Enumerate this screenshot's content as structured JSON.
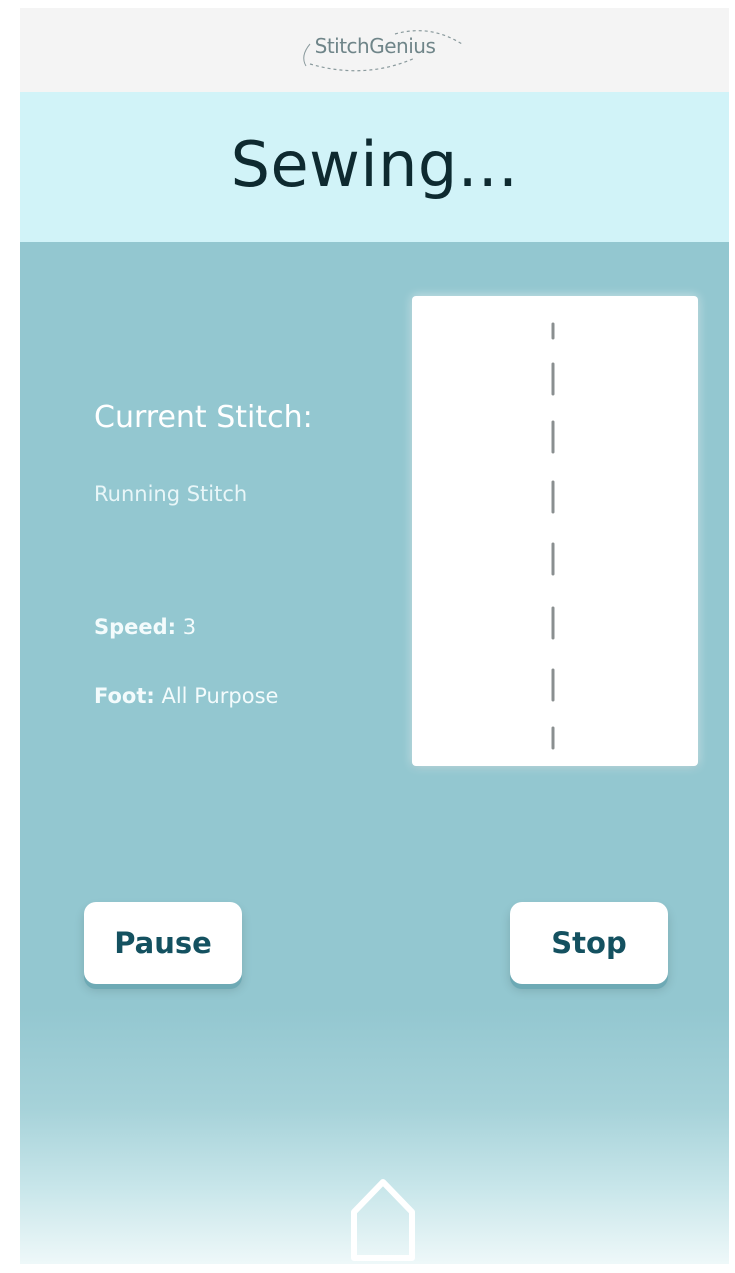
{
  "app": {
    "logo_text": "StitchGenius"
  },
  "header": {
    "title": "Sewing..."
  },
  "stitch_info": {
    "current_label": "Current Stitch:",
    "current_value": "Running Stitch",
    "speed_label": "Speed:",
    "speed_value": "3",
    "foot_label": "Foot:",
    "foot_value": "All Purpose"
  },
  "preview": {
    "stitch_color": "#8a8f90",
    "icon": "running-stitch-preview"
  },
  "controls": {
    "pause_label": "Pause",
    "stop_label": "Stop"
  },
  "nav": {
    "home_icon": "home-icon"
  },
  "colors": {
    "background": "#93c7d0",
    "title_bar": "#d1f3f8",
    "button_text": "#145160"
  }
}
